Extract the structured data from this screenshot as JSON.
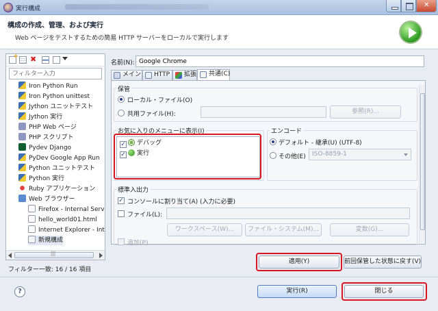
{
  "window": {
    "title": "実行構成"
  },
  "banner": {
    "title": "構成の作成、管理、および実行",
    "description": "Web ページをテストするための簡易 HTTP サーバーをローカルで実行します"
  },
  "left": {
    "filter_placeholder": "フィルター入力",
    "items": [
      {
        "label": "Iron Python Run",
        "icon": "python-icon"
      },
      {
        "label": "Iron Python unittest",
        "icon": "python-icon"
      },
      {
        "label": "Jython ユニットテスト",
        "icon": "python-icon"
      },
      {
        "label": "Jython 実行",
        "icon": "python-icon"
      },
      {
        "label": "PHP Web ページ",
        "icon": "php-icon"
      },
      {
        "label": "PHP スクリプト",
        "icon": "php-icon"
      },
      {
        "label": "Pydev Django",
        "icon": "django-icon"
      },
      {
        "label": "PyDev Google App Run",
        "icon": "python-icon"
      },
      {
        "label": "Python ユニットテスト",
        "icon": "python-icon"
      },
      {
        "label": "Python 実行",
        "icon": "python-icon"
      },
      {
        "label": "Ruby アプリケーション",
        "icon": "ruby-icon"
      },
      {
        "label": "Web ブラウザー",
        "icon": "web-icon"
      },
      {
        "label": "Firefox - Internal Serv",
        "icon": "document-icon"
      },
      {
        "label": "hello_world01.html",
        "icon": "document-icon"
      },
      {
        "label": "Internet Explorer - Int",
        "icon": "document-icon"
      },
      {
        "label": "新規構成",
        "icon": "new-config-icon"
      }
    ],
    "scroll_thumb_text": "|||",
    "filter_status": "フィルター一致: 16 / 16 項目"
  },
  "right": {
    "name_label": "名前(N):",
    "name_value": "Google Chrome",
    "tabs": [
      {
        "label": "メイン",
        "icon": "main-tab-icon"
      },
      {
        "label": "HTTP",
        "icon": "http-tab-icon"
      },
      {
        "label": "拡張",
        "icon": "extension-tab-icon"
      },
      {
        "label": "共通(C)",
        "icon": "common-tab-icon",
        "active": true
      }
    ],
    "save": {
      "title": "保管",
      "local_file": "ローカル・ファイル(O)",
      "shared_file": "共用ファイル(H):",
      "browse_button": "参照(R)..."
    },
    "favorites": {
      "title": "お気に入りのメニューに表示(I)",
      "items": [
        {
          "label": "デバッグ",
          "checked": true
        },
        {
          "label": "実行",
          "checked": true
        }
      ]
    },
    "encoding": {
      "title": "エンコード",
      "default": "デフォルト - 継承(U) (UTF-8)",
      "other": "その他(E)",
      "other_value": "ISO-8859-1"
    },
    "io": {
      "title": "標準入出力",
      "console": "コンソールに割り当て(A) (入力に必要)",
      "file": "ファイル(L):",
      "workspace_button": "ワークスペース(W)...",
      "filesystem_button": "ファイル・システム(M)...",
      "variables_button": "変数(G)...",
      "append": "追加(P)"
    },
    "apply_button": "適用(Y)",
    "revert_button": "前回保管した状態に戻す(V)"
  },
  "footer": {
    "run_button": "実行(R)",
    "close_button": "閉じる"
  },
  "colors": {
    "highlight": "#d8161f",
    "accent": "#1f3f86"
  }
}
